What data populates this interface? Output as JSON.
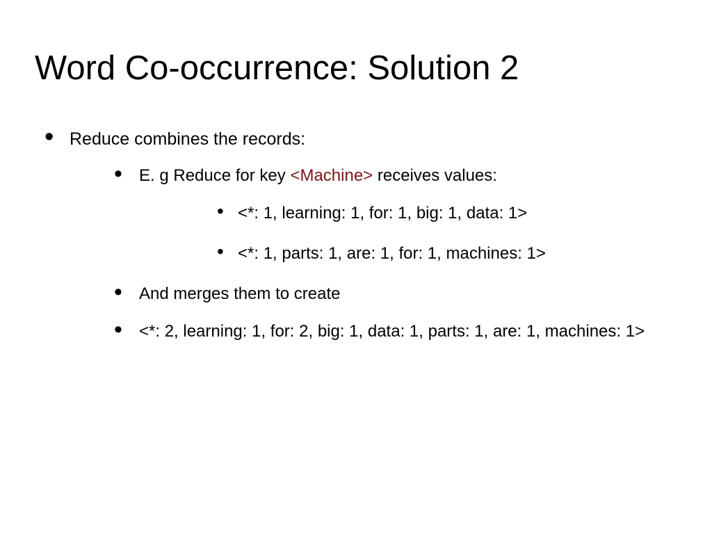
{
  "colors": {
    "keyword": "#7c1616"
  },
  "title": "Word Co-occurrence: Solution 2",
  "bullets": {
    "l1_text": "Reduce combines the records:",
    "l2a_prefix": "E. g  Reduce for key ",
    "l2a_kw": "<Machine>",
    "l2a_suffix": " receives values:",
    "l3a": "<*: 1, learning: 1, for: 1, big: 1, data: 1>",
    "l3b": "<*: 1, parts: 1, are: 1, for: 1, machines: 1>",
    "l2b": "And merges them to create",
    "l2c": "<*: 2, learning: 1, for: 2, big: 1, data: 1, parts: 1, are: 1, machines: 1>"
  }
}
